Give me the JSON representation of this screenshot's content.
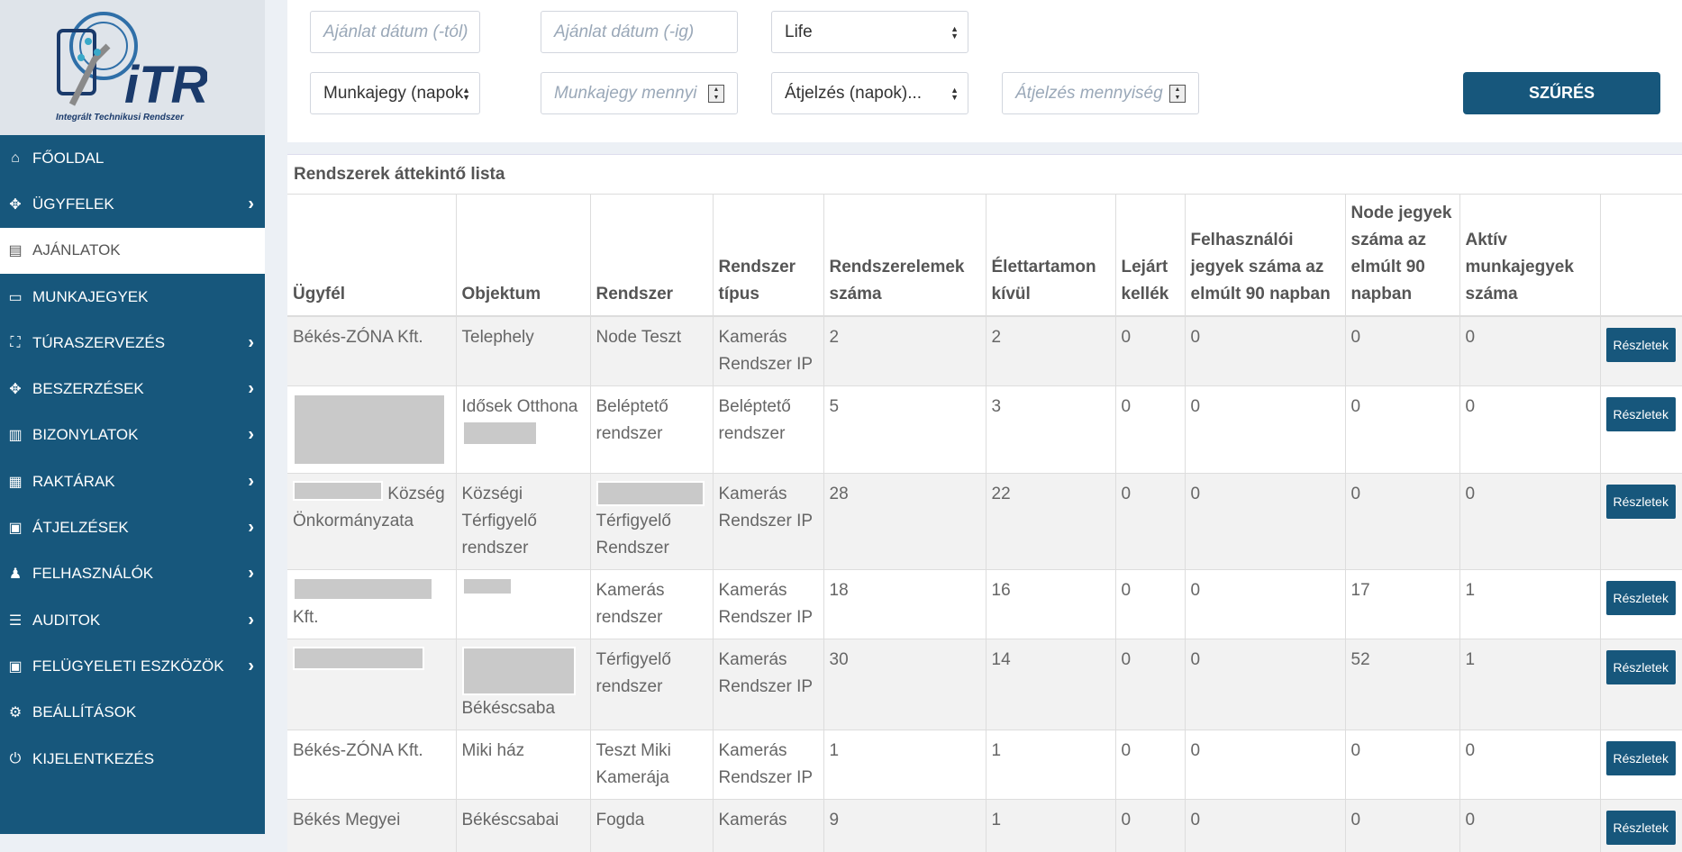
{
  "logo": {
    "brand": "iTR",
    "caption": "Integrált Technikusi Rendszer"
  },
  "sidebar": {
    "items": [
      {
        "label": "FŐOLDAL",
        "icon": "home-icon",
        "active": false,
        "submenu": false
      },
      {
        "label": "ÜGYFELEK",
        "icon": "handshake-icon",
        "active": false,
        "submenu": true
      },
      {
        "label": "AJÁNLATOK",
        "icon": "document-icon",
        "active": true,
        "submenu": false
      },
      {
        "label": "MUNKAJEGYEK",
        "icon": "ticket-icon",
        "active": false,
        "submenu": false
      },
      {
        "label": "TÚRASZERVEZÉS",
        "icon": "route-icon",
        "active": false,
        "submenu": true
      },
      {
        "label": "BESZERZÉSEK",
        "icon": "handshake-icon",
        "active": false,
        "submenu": true
      },
      {
        "label": "BIZONYLATOK",
        "icon": "receipt-icon",
        "active": false,
        "submenu": true
      },
      {
        "label": "RAKTÁRAK",
        "icon": "warehouse-icon",
        "active": false,
        "submenu": true
      },
      {
        "label": "ÁTJELZÉSEK",
        "icon": "alarm-panel-icon",
        "active": false,
        "submenu": true
      },
      {
        "label": "FELHASZNÁLÓK",
        "icon": "users-icon",
        "active": false,
        "submenu": true
      },
      {
        "label": "AUDITOK",
        "icon": "audit-icon",
        "active": false,
        "submenu": true
      },
      {
        "label": "FELÜGYELETI ESZKÖZÖK",
        "icon": "monitor-icon",
        "active": false,
        "submenu": true
      },
      {
        "label": "BEÁLLÍTÁSOK",
        "icon": "gear-icon",
        "active": false,
        "submenu": false
      },
      {
        "label": "KIJELENTKEZÉS",
        "icon": "power-icon",
        "active": false,
        "submenu": false
      }
    ]
  },
  "filters": {
    "date_from_placeholder": "Ajánlat dátum (-tól)",
    "date_to_placeholder": "Ajánlat dátum (-ig)",
    "life_select_value": "Life",
    "ticket_days_select_value": "Munkajegy (napok",
    "ticket_qty_placeholder": "Munkajegy mennyi",
    "alarm_days_select_value": "Átjelzés (napok)...",
    "alarm_qty_placeholder": "Átjelzés mennyiség",
    "filter_button": "SZŰRÉS"
  },
  "list": {
    "title": "Rendszerek áttekintő lista",
    "columns": [
      "Ügyfél",
      "Objektum",
      "Rendszer",
      "Rendszer típus",
      "Rendszerelemek száma",
      "Élettartamon kívül",
      "Lejárt kellék",
      "Felhasználói jegyek száma az elmúlt 90 napban",
      "Node jegyek száma az elmúlt 90 napban",
      "Aktív munkajegyek száma",
      ""
    ],
    "details_label": "Részletek",
    "rows": [
      {
        "client": "Békés-ZÓNA Kft.",
        "object": "Telephely",
        "system": "Node Teszt",
        "type": "Kamerás Rendszer IP",
        "elements": "2",
        "out_of_life": "2",
        "expired": "0",
        "user_tickets": "0",
        "node_tickets": "0",
        "active_tickets": "0"
      },
      {
        "client": "",
        "object": "Idősek Otthona",
        "system": "Beléptető rendszer",
        "type": "Beléptető rendszer",
        "elements": "5",
        "out_of_life": "3",
        "expired": "0",
        "user_tickets": "0",
        "node_tickets": "0",
        "active_tickets": "0"
      },
      {
        "client": "Község Önkormányzata",
        "object": "Községi Térfigyelő rendszer",
        "system": "Térfigyelő Rendszer",
        "type": "Kamerás Rendszer IP",
        "elements": "28",
        "out_of_life": "22",
        "expired": "0",
        "user_tickets": "0",
        "node_tickets": "0",
        "active_tickets": "0"
      },
      {
        "client": "Kft.",
        "object": "",
        "system": "Kamerás rendszer",
        "type": "Kamerás Rendszer IP",
        "elements": "18",
        "out_of_life": "16",
        "expired": "0",
        "user_tickets": "0",
        "node_tickets": "17",
        "active_tickets": "1"
      },
      {
        "client": "",
        "object": "Békéscsaba",
        "system": "Térfigyelő rendszer",
        "type": "Kamerás Rendszer IP",
        "elements": "30",
        "out_of_life": "14",
        "expired": "0",
        "user_tickets": "0",
        "node_tickets": "52",
        "active_tickets": "1"
      },
      {
        "client": "Békés-ZÓNA Kft.",
        "object": "Miki ház",
        "system": "Teszt Miki Kamerája",
        "type": "Kamerás Rendszer IP",
        "elements": "1",
        "out_of_life": "1",
        "expired": "0",
        "user_tickets": "0",
        "node_tickets": "0",
        "active_tickets": "0"
      },
      {
        "client": "Békés Megyei",
        "object": "Békéscsabai",
        "system": "Fogda",
        "type": "Kamerás",
        "elements": "9",
        "out_of_life": "1",
        "expired": "0",
        "user_tickets": "0",
        "node_tickets": "0",
        "active_tickets": "0"
      }
    ]
  },
  "colors": {
    "sidebar_bg": "#17577c",
    "accent": "#17577c",
    "page_bg": "#ecf0f5"
  }
}
